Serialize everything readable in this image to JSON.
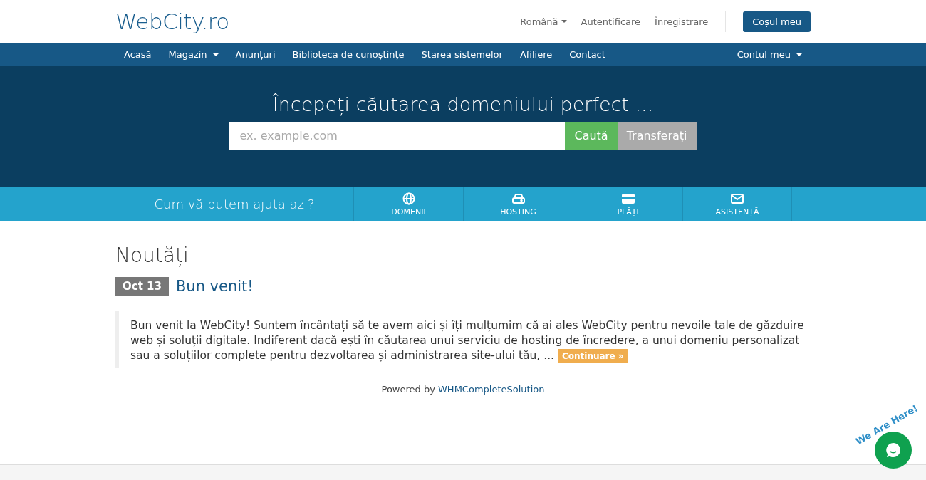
{
  "logo": "WebCity.ro",
  "top_links": [
    {
      "label": "Română",
      "kind": "dropdown"
    },
    {
      "label": "Autentificare",
      "kind": "link"
    },
    {
      "label": "Înregistrare",
      "kind": "link"
    }
  ],
  "cart_button": "Coșul meu",
  "nav": {
    "items": [
      {
        "label": "Acasă",
        "dropdown": false
      },
      {
        "label": "Magazin",
        "dropdown": true
      },
      {
        "label": "Anunțuri",
        "dropdown": false
      },
      {
        "label": "Biblioteca de cunoștințe",
        "dropdown": false
      },
      {
        "label": "Starea sistemelor",
        "dropdown": false
      },
      {
        "label": "Afiliere",
        "dropdown": false
      },
      {
        "label": "Contact",
        "dropdown": false
      }
    ],
    "account": {
      "label": "Contul meu",
      "dropdown": true
    }
  },
  "hero": {
    "title": "Începeți căutarea domeniului perfect ...",
    "search": {
      "placeholder": "ex. example.com"
    },
    "buttons": [
      {
        "label": "Caută",
        "kind": "search"
      },
      {
        "label": "Transferați",
        "kind": "transfer"
      }
    ]
  },
  "help_bar": {
    "title": "Cum vă putem ajuta azi?",
    "items": [
      {
        "label": "DOMENII",
        "kind": "globe"
      },
      {
        "label": "HOSTING",
        "kind": "server"
      },
      {
        "label": "PLĂȚI",
        "kind": "card"
      },
      {
        "label": "ASISTENȚĂ",
        "kind": "mail"
      }
    ]
  },
  "news": {
    "heading": "Noutăți",
    "items": [
      {
        "date": "Oct 13",
        "title": "Bun venit!",
        "text": "Bun venit la WebCity! Suntem încântați să te avem aici și îți mulțumim că ai ales WebCity pentru nevoile tale de găzduire web și soluții digitale. Indiferent dacă ești în căutarea unui serviciu de hosting de încredere, a unui domeniu personalizat sau a soluțiilor complete pentru dezvoltarea și administrarea site-ului tău, ...",
        "more": "Continuare »"
      }
    ]
  },
  "powered": {
    "prefix": "Powered by",
    "link": "WHMCompleteSolution"
  },
  "chat_widget": {
    "tagline": "We Are Here!"
  }
}
